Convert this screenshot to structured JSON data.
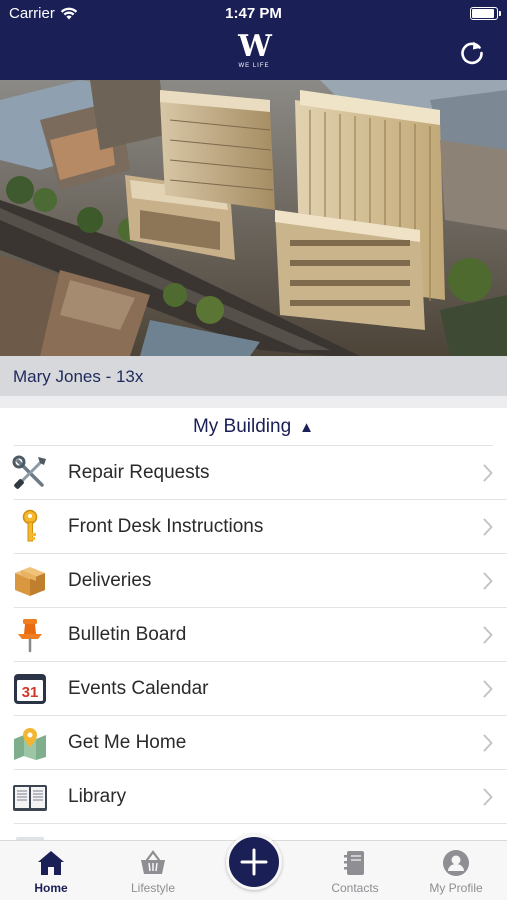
{
  "status_bar": {
    "carrier": "Carrier",
    "time": "1:47 PM"
  },
  "header": {
    "logo_letter": "W",
    "logo_text": "WE LIFE",
    "refresh_icon": "refresh-icon"
  },
  "resident": {
    "name": "Mary Jones - 13x"
  },
  "section": {
    "title": "My Building",
    "toggle_icon": "caret-up-icon"
  },
  "menu_items": [
    {
      "label": "Repair Requests",
      "icon": "tools-icon"
    },
    {
      "label": "Front Desk Instructions",
      "icon": "key-icon"
    },
    {
      "label": "Deliveries",
      "icon": "package-icon"
    },
    {
      "label": "Bulletin Board",
      "icon": "pushpin-icon"
    },
    {
      "label": "Events Calendar",
      "icon": "calendar-icon",
      "icon_text": "31"
    },
    {
      "label": "Get Me Home",
      "icon": "map-pin-icon"
    },
    {
      "label": "Library",
      "icon": "book-icon"
    }
  ],
  "tabs": [
    {
      "label": "Home",
      "icon": "house-icon",
      "active": true
    },
    {
      "label": "Lifestyle",
      "icon": "basket-icon",
      "active": false
    },
    {
      "label": "",
      "icon": "plus-icon",
      "active": false
    },
    {
      "label": "Contacts",
      "icon": "contacts-book-icon",
      "active": false
    },
    {
      "label": "My Profile",
      "icon": "profile-icon",
      "active": false
    }
  ],
  "colors": {
    "brand_navy": "#1a1f56",
    "resident_bar": "#d7d8db",
    "inactive_tab": "#8e8e93"
  }
}
